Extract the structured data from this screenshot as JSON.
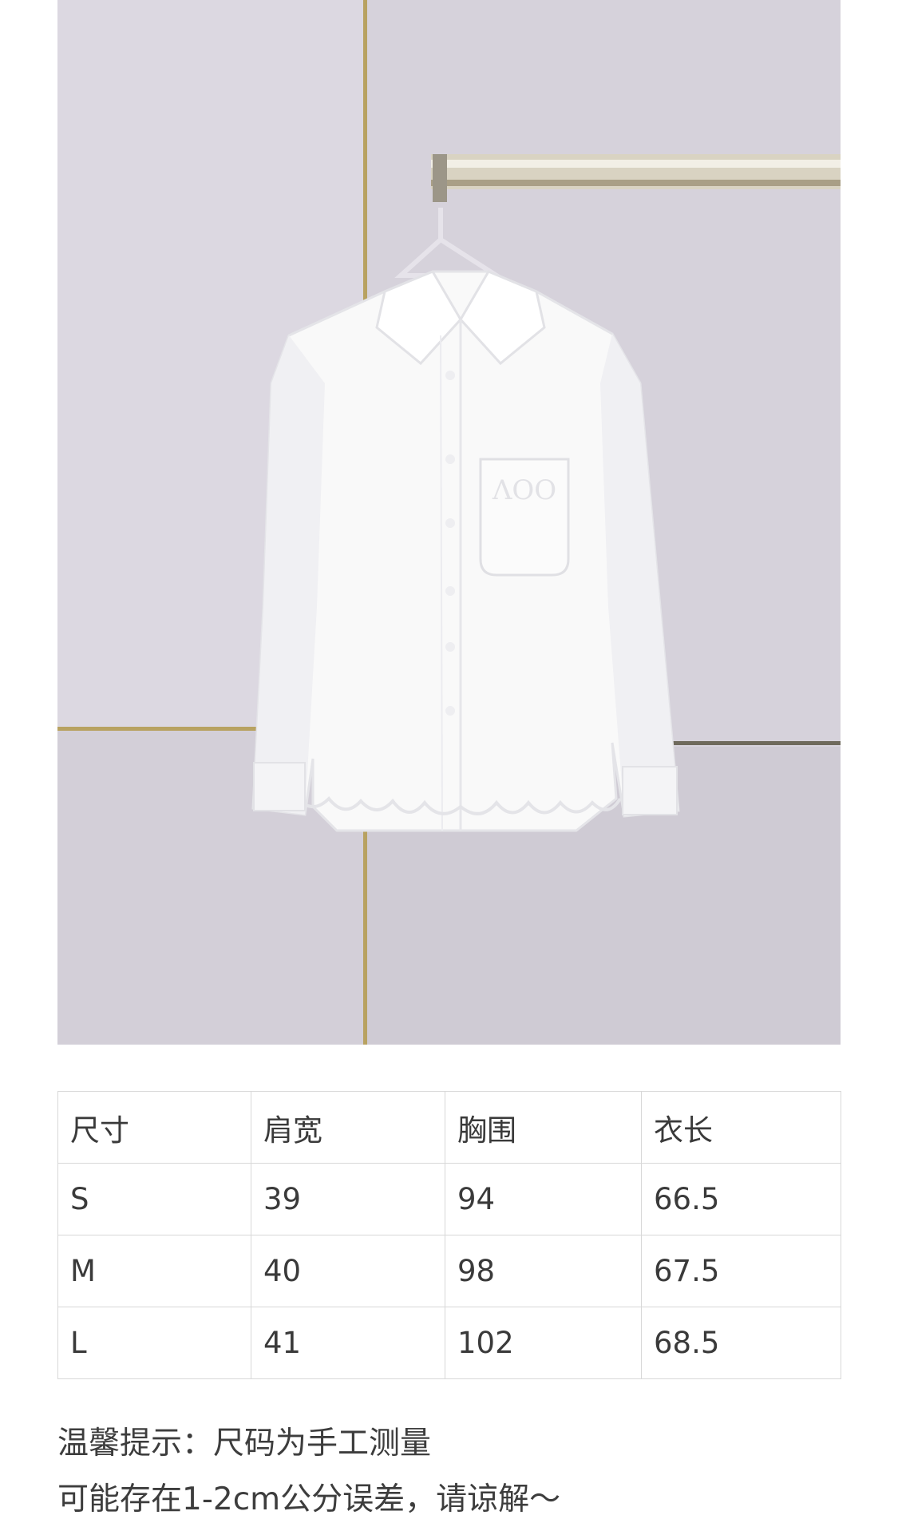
{
  "product_photo": {
    "description_icon": "white-shirt-photo",
    "wall_color": "#d9d5de",
    "trim_color": "#b9a360",
    "shirt_color": "#fbfbfb"
  },
  "size_table": {
    "headers": [
      "尺寸",
      "肩宽",
      "胸围",
      "衣长"
    ],
    "rows": [
      [
        "S",
        "39",
        "94",
        "66.5"
      ],
      [
        "M",
        "40",
        "98",
        "67.5"
      ],
      [
        "L",
        "41",
        "102",
        "68.5"
      ]
    ]
  },
  "notes": {
    "line1": "温馨提示：尺码为手工测量",
    "line2": "可能存在1-2cm公分误差，请谅解～"
  }
}
